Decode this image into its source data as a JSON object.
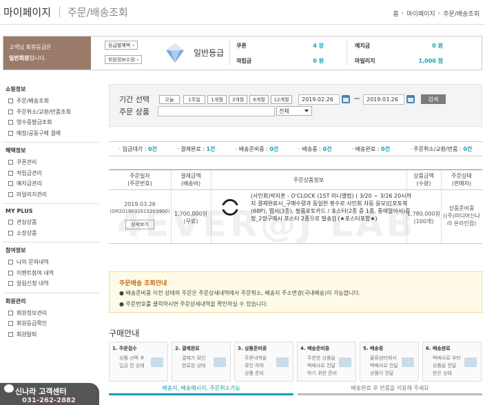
{
  "header": {
    "title": "마이페이지",
    "subtitle": "주문/배송조회",
    "breadcrumb": [
      "홈",
      "마이페이지",
      "주문/배송조회"
    ]
  },
  "member": {
    "grade_text_line1": "고객님 회원등급은",
    "grade_name_bold": "일반회원",
    "grade_text_line2_suffix": "입니다.",
    "benefit_button": "등급별혜택",
    "edit_button": "회원정보수정",
    "grade_label": "일반등급",
    "coupon_label": "쿠폰",
    "coupon_value": "4 장",
    "points_label": "적립금",
    "points_value": "0 원",
    "deposit_label": "예치금",
    "deposit_value": "0 원",
    "mileage_label": "마일리지",
    "mileage_value": "1,000 점"
  },
  "nav": {
    "sections": [
      {
        "title": "쇼핑정보",
        "items": [
          "주문/배송조회",
          "주문취소/교환/반품조회",
          "영수증발급조회",
          "매장/공동구매 결제"
        ]
      },
      {
        "title": "혜택정보",
        "items": [
          "쿠폰관리",
          "적립금관리",
          "예치금관리",
          "마일리지관리"
        ]
      },
      {
        "title": "MY PLUS",
        "items": [
          "관심상품",
          "소장상품"
        ]
      },
      {
        "title": "참여정보",
        "items": [
          "나의 문의내역",
          "이벤트참여 내역",
          "알림신청 내역"
        ]
      },
      {
        "title": "회원관리",
        "items": [
          "회원정보관리",
          "회원등급확인",
          "회원탈퇴"
        ]
      }
    ]
  },
  "search": {
    "period_label": "기간 선택",
    "product_label": "주문 상품",
    "periods": [
      "오늘",
      "1주일",
      "1개월",
      "3개월",
      "6개월",
      "12개월"
    ],
    "date_from": "2019.02.26",
    "date_to": "2019.03.26",
    "search_button": "검색",
    "select_value": "전체"
  },
  "status": [
    {
      "label": "입금대기 :",
      "count": "0건"
    },
    {
      "label": "결제완료 :",
      "count": "1건"
    },
    {
      "label": "배송준비중 :",
      "count": "0건"
    },
    {
      "label": "배송중 :",
      "count": "0건"
    },
    {
      "label": "배송완료 :",
      "count": "0건"
    },
    {
      "label": "주문취소/교환/반품 :",
      "count": "0건"
    }
  ],
  "table": {
    "headers": [
      [
        "주문일자",
        "(주문번호)"
      ],
      [
        "결제금액",
        "(배송비)"
      ],
      [
        "주문상품정보"
      ],
      [
        "상품금액",
        "(수량)"
      ],
      [
        "주문상태",
        "(판매자)"
      ]
    ],
    "row": {
      "date": "2019.03.26",
      "order_no": "(OR20190326152039​00)",
      "detail_button": "상세보기",
      "pay_amount": "1,700,000원",
      "shipping": "(무료)",
      "product_info": "(사인회)박지훈 - O'CLOCK (1ST 미니앨범) ( 3/20 ~ 3/26 20시까지 결제완료시_구매수량과 동일한 횟수로 사인회 자동 응모)[[포토북(68P), 엽서(3종), 필름포토카드 / 포스터(2종 중 1종, 통에말아서)증정_2장구매시 포스터 2종으로 발송]] (★포스터포함★)",
      "price": "1,780,000원",
      "qty": "(100개)",
      "state": "상품준비중",
      "seller": "((주)미디어신나라 온라인점)"
    }
  },
  "watermark": "4EVER@J LAB",
  "guide": {
    "title": "주문배송 조회안내",
    "lines": [
      "배송준비중 이전 상태의 주문은 주문상세내역에서 주문취소, 배송지 주소변경(국내배송)이 가능합니다.",
      "주문번호를 클릭하시면 주문상세내역을 확인하실 수 있습니다."
    ]
  },
  "purchase": {
    "title": "구매안내",
    "steps": [
      {
        "title": "1. 주문접수",
        "desc": [
          "상품 선택 후",
          "입금 전 상태"
        ]
      },
      {
        "title": "2. 결제완료",
        "desc": [
          "결제가 확인",
          "완료된 상태"
        ]
      },
      {
        "title": "3. 상품준비중",
        "desc": [
          "주문내역을",
          "확인 하여",
          "상품 준비"
        ]
      },
      {
        "title": "4. 배송준비중",
        "desc": [
          "주문한 상품을",
          "택배사로 전달",
          "하기 위한 준비"
        ]
      },
      {
        "title": "5. 배송중",
        "desc": [
          "물류센터에서",
          "택배사로 전달",
          "상품이 전달"
        ]
      },
      {
        "title": "6. 배송완료",
        "desc": [
          "택배사로 부터",
          "상품을 전달",
          "받은 상태"
        ]
      }
    ],
    "bar_left": "배송지, 배송메시지, 주문취소가능",
    "bar_right": "배송완료 후 반품을 이용해 주세요"
  },
  "customer_center": {
    "name": "신나라 고객센터",
    "phone": "031-262-2882"
  },
  "colors": {
    "grade_bg": "#9a7b69",
    "accent": "#1a9ab5",
    "guide_title": "#c46a12"
  }
}
